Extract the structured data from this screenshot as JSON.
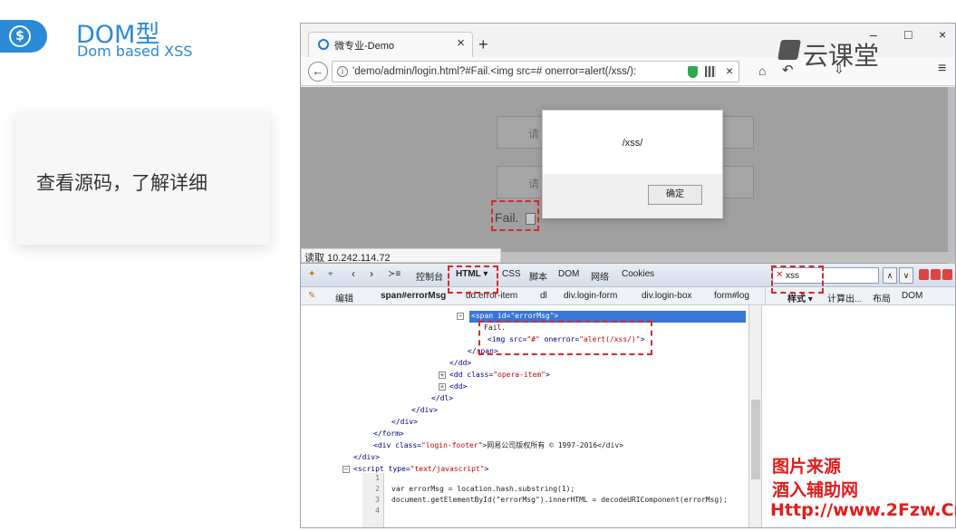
{
  "slide": {
    "logo_glyph": "$",
    "title": "DOM型",
    "subtitle": "Dom based XSS",
    "note": "查看源码，了解详细"
  },
  "browser": {
    "tab_title": "微专业-Demo",
    "tab_close": "×",
    "new_tab": "+",
    "window_buttons": {
      "minimize": "–",
      "maximize": "□",
      "close": "×"
    },
    "back": "←",
    "info": "i",
    "url": "'demo/admin/login.html?#Fail.<img src=# onerror=alert(/xss/):",
    "url_close": "×",
    "menu": "≡",
    "watermark": "云课堂",
    "page": {
      "input1_placeholder": "请",
      "input2_placeholder": "请",
      "fail_text": "Fail."
    },
    "alert": {
      "message": "/xss/",
      "ok_label": "确定"
    },
    "status_text": "读取 10.242.114.72"
  },
  "devtools": {
    "tools": [
      "控制台",
      "HTML ▾",
      "CSS",
      "脚本",
      "DOM",
      "网络",
      "Cookies"
    ],
    "search_value": "xss",
    "search_clear": "✕",
    "arrow_up": "∧",
    "arrow_down": "∨",
    "edit_label": "编辑",
    "breadcrumbs": [
      "span#errorMsg",
      "dd.error-item",
      "dl",
      "div.login-form",
      "div.login-box",
      "form#log"
    ],
    "side_tabs": [
      "样式 ▾",
      "计算出...",
      "布局",
      "DOM"
    ],
    "tree": {
      "span_open": "<span id=\"errorMsg\">",
      "fail": "Fail.",
      "img_tag_open": "<img",
      "img_src_attr": "src=",
      "img_src_val": "\"#\"",
      "img_onerror_attr": "onerror=",
      "img_onerror_val": "\"alert(/xss/)\"",
      "img_tag_close": ">",
      "span_close": "</span>",
      "dd_close": "</dd>",
      "dd_opera_open": "<dd",
      "dd_opera_attr": "class=",
      "dd_opera_val": "\"opera-item\"",
      "dd_opera_close": ">",
      "dd_simple": "<dd>",
      "dl_close": "</dl>",
      "div_close_1": "</div>",
      "div_close_2": "</div>",
      "form_close": "</form>",
      "footer_open": "<div",
      "footer_attr": "class=",
      "footer_val": "\"login-footer\"",
      "footer_text": ">网易公司版权所有 © 1997-2016</div>",
      "div_close_3": "</div>",
      "script_open": "<script",
      "script_attr": "type=",
      "script_val": "\"text/javascript\"",
      "script_gt": ">",
      "line_numbers": [
        "1",
        "2",
        "3",
        "4"
      ],
      "code_line_2": "var errorMsg = location.hash.substring(1);",
      "code_line_3": "document.getElementById(\"errorMsg\").innerHTML = decodeURIComponent(errorMsg);"
    }
  },
  "site_watermark": {
    "line1": "图片来源",
    "line2": "酒入辅助网",
    "line3": "Http://www.2Fzw.Cn"
  },
  "colors": {
    "accent": "#2a8ad6",
    "highlight": "#d42a2a",
    "selection": "#3875d7"
  }
}
